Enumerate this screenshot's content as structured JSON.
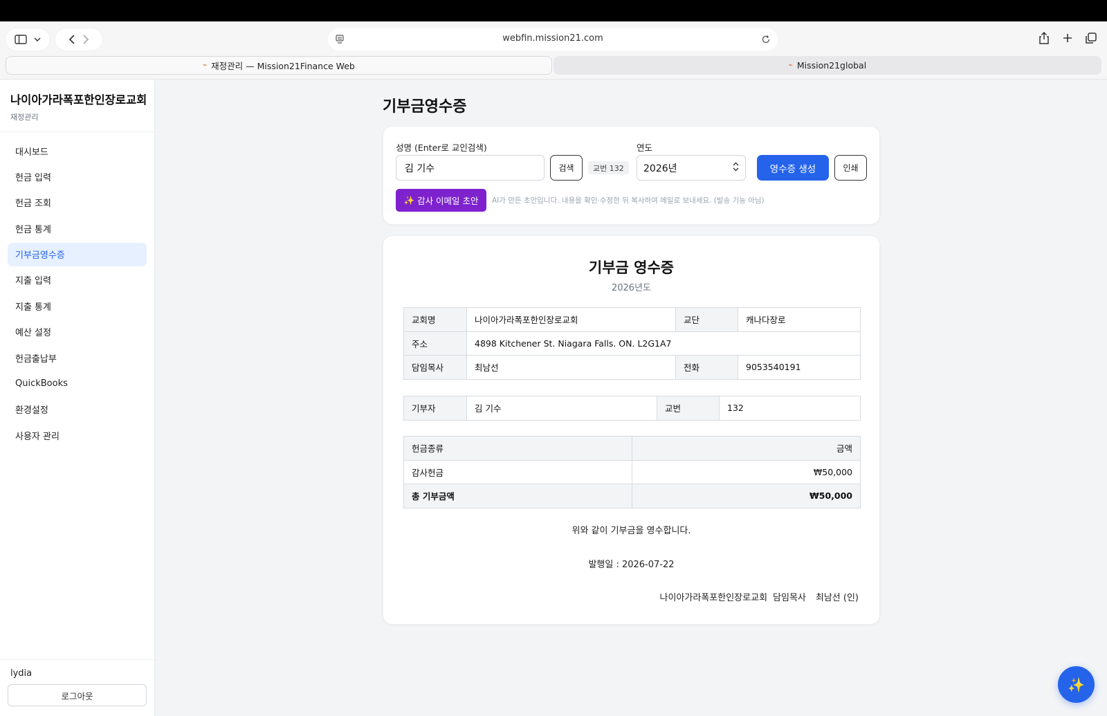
{
  "browser": {
    "url": "webfin.mission21.com",
    "tabs": [
      {
        "title": "재정관리 — Mission21Finance Web",
        "active": true
      },
      {
        "title": "Mission21global",
        "active": false
      }
    ]
  },
  "sidebar": {
    "church_name": "나이아가라폭포한인장로교회",
    "subtitle": "재정관리",
    "items": [
      {
        "label": "대시보드"
      },
      {
        "label": "헌금 입력"
      },
      {
        "label": "헌금 조회"
      },
      {
        "label": "헌금 통계"
      },
      {
        "label": "기부금영수증",
        "active": true
      },
      {
        "label": "지출 입력"
      },
      {
        "label": "지출 통계"
      },
      {
        "label": "예산 설정"
      },
      {
        "label": "헌금출납부"
      },
      {
        "label": "QuickBooks"
      },
      {
        "label": "환경설정"
      },
      {
        "label": "사용자 관리"
      }
    ],
    "user": "lydia",
    "logout_label": "로그아웃"
  },
  "page": {
    "title": "기부금영수증"
  },
  "form": {
    "name_label": "성명 (Enter로 교인검색)",
    "name_value": "김 기수",
    "search_label": "검색",
    "member_badge": "교번 132",
    "year_label": "연도",
    "year_value": "2026년",
    "generate_label": "영수증 생성",
    "print_label": "인쇄",
    "email_draft_label": "감사 이메일 초안",
    "email_draft_icon": "sparkles-icon",
    "email_note": "AI가 만든 초안입니다. 내용을 확인·수정한 뒤 복사하여 메일로 보내세요. (발송 기능 아님)"
  },
  "receipt": {
    "title": "기부금 영수증",
    "year_text": "2026년도",
    "church_label": "교회명",
    "church_value": "나이아가라폭포한인장로교회",
    "denomination_label": "교단",
    "denomination_value": "캐나다장로",
    "address_label": "주소",
    "address_value": "4898 Kitchener St. Niagara Falls. ON. L2G1A7",
    "pastor_label": "담임목사",
    "pastor_value": "최남선",
    "phone_label": "전화",
    "phone_value": "9053540191",
    "donor_label": "기부자",
    "donor_value": "김 기수",
    "member_no_label": "교번",
    "member_no_value": "132",
    "offering_type_header": "헌금종류",
    "amount_header": "금액",
    "rows": [
      {
        "type": "감사헌금",
        "amount": "₩50,000"
      }
    ],
    "total_label": "총 기부금액",
    "total_value": "₩50,000",
    "statement": "위와 같이 기부금을 영수합니다.",
    "issue_date": "발행일 : 2026-07-22",
    "sign_church": "나이아가라폭포한인장로교회",
    "sign_role": "담임목사",
    "sign_name": "최남선 (인)"
  },
  "fab_icon": "sparkles-icon",
  "colors": {
    "primary": "#2563eb",
    "ai_purple": "#7e22ce",
    "active_nav_bg": "#e6f0ff"
  }
}
